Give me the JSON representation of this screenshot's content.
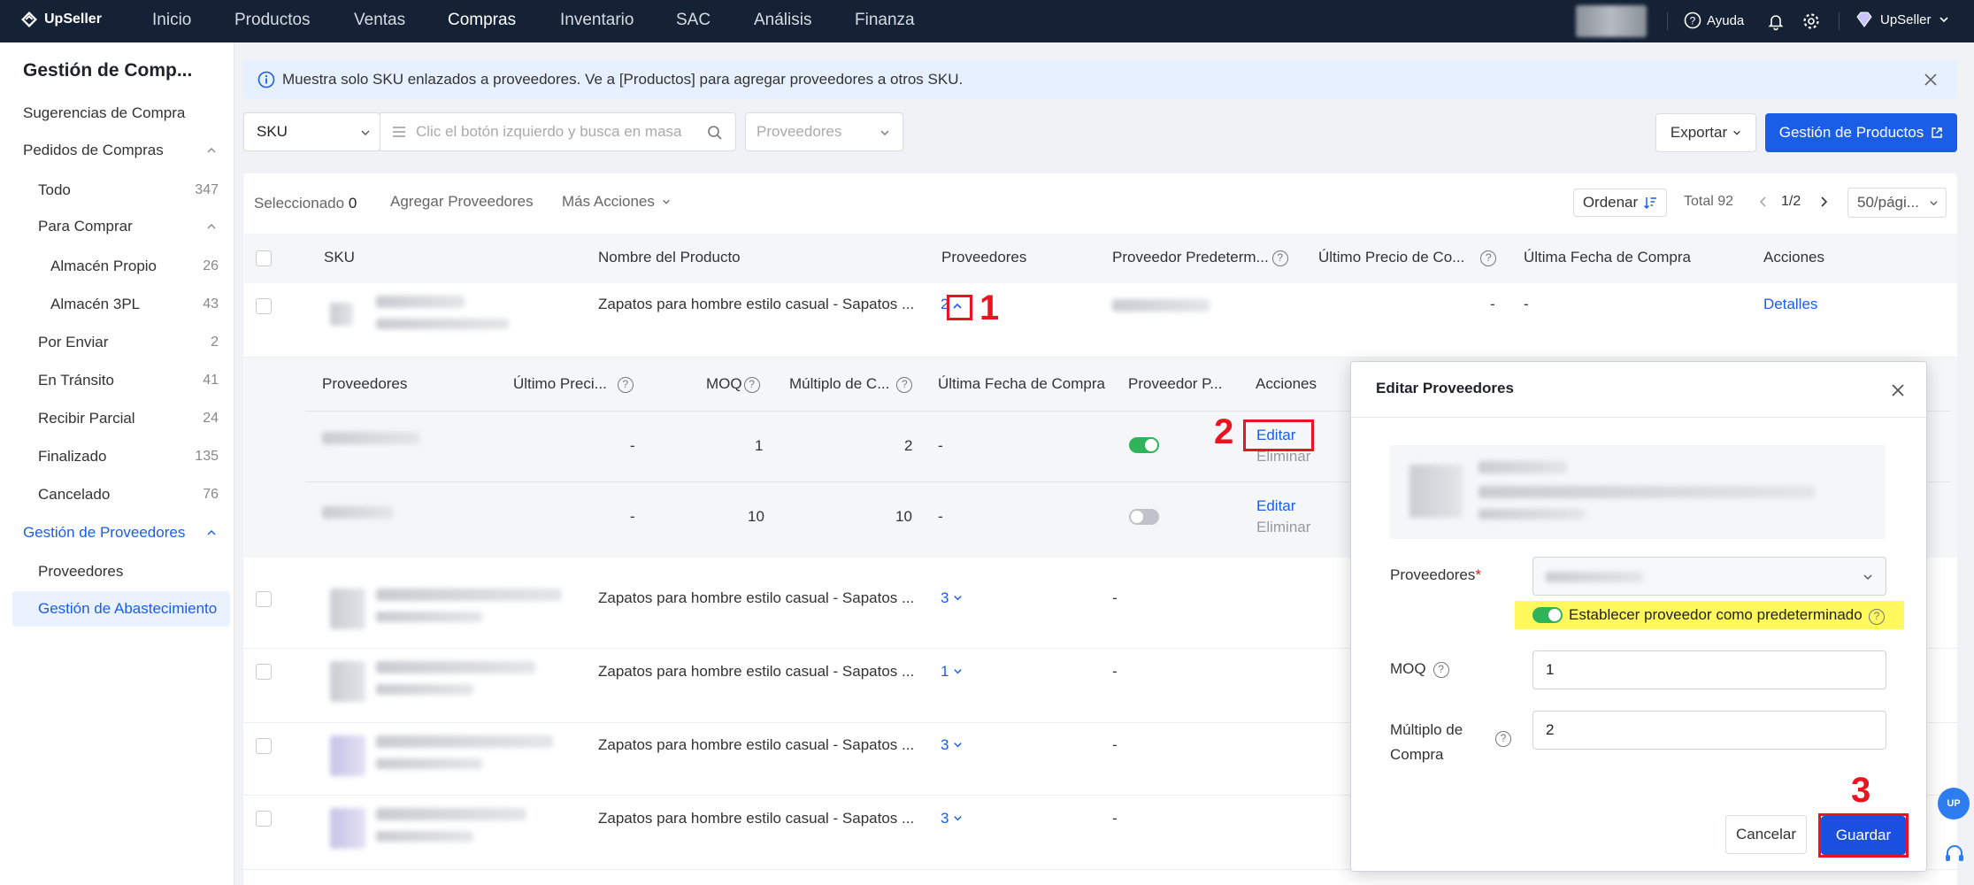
{
  "topnav": {
    "brand": "UpSeller",
    "items": [
      "Inicio",
      "Productos",
      "Ventas",
      "Compras",
      "Inventario",
      "SAC",
      "Análisis",
      "Finanza"
    ],
    "active": "Compras",
    "help": "Ayuda",
    "user": "UpSeller"
  },
  "sidebar": {
    "title": "Gestión de Comp...",
    "sugerencias": "Sugerencias de Compra",
    "pedidos": "Pedidos de Compras",
    "todo": {
      "label": "Todo",
      "count": "347"
    },
    "para_comprar": "Para Comprar",
    "almacen_propio": {
      "label": "Almacén Propio",
      "count": "26"
    },
    "almacen_3pl": {
      "label": "Almacén 3PL",
      "count": "43"
    },
    "por_enviar": {
      "label": "Por Enviar",
      "count": "2"
    },
    "en_transito": {
      "label": "En Tránsito",
      "count": "41"
    },
    "recibir_parcial": {
      "label": "Recibir Parcial",
      "count": "24"
    },
    "finalizado": {
      "label": "Finalizado",
      "count": "135"
    },
    "cancelado": {
      "label": "Cancelado",
      "count": "76"
    },
    "gestion_proveedores": "Gestión de Proveedores",
    "proveedores": "Proveedores",
    "abastecimiento": "Gestión de Abastecimiento"
  },
  "banner": {
    "text": "Muestra solo SKU enlazados a proveedores. Ve a [Productos] para agregar proveedores a otros SKU."
  },
  "filters": {
    "sku_select": "SKU",
    "search_placeholder": "Clic el botón izquierdo y busca en masa",
    "proveedores_placeholder": "Proveedores",
    "exportar": "Exportar",
    "gestion_productos": "Gestión de Productos"
  },
  "toolbar": {
    "seleccionado": "Seleccionado",
    "seleccionado_count": "0",
    "agregar": "Agregar Proveedores",
    "mas_acciones": "Más Acciones",
    "ordenar": "Ordenar",
    "total": "Total 92",
    "page": "1/2",
    "page_size": "50/pági..."
  },
  "table": {
    "headers": {
      "sku": "SKU",
      "nombre": "Nombre del Producto",
      "proveedores": "Proveedores",
      "predeterminado": "Proveedor Predeterm...",
      "ultimo_precio": "Último Precio de Co...",
      "ultima_fecha": "Última Fecha de Compra",
      "acciones": "Acciones"
    },
    "first_row": {
      "nombre": "Zapatos para hombre estilo casual - Sapatos ...",
      "proveedores": "2",
      "precio": "-",
      "fecha": "-",
      "accion": "Detalles"
    },
    "rows": [
      {
        "nombre": "Zapatos para hombre estilo casual - Sapatos ...",
        "proveedores": "3",
        "predeterminado": "-"
      },
      {
        "nombre": "Zapatos para hombre estilo casual - Sapatos ...",
        "proveedores": "1",
        "predeterminado": "-"
      },
      {
        "nombre": "Zapatos para hombre estilo casual - Sapatos ...",
        "proveedores": "3",
        "predeterminado": "-"
      },
      {
        "nombre": "Zapatos para hombre estilo casual - Sapatos ...",
        "proveedores": "3",
        "predeterminado": "-"
      }
    ]
  },
  "subtable": {
    "headers": {
      "proveedores": "Proveedores",
      "ultimo_precio": "Último Preci...",
      "moq": "MOQ",
      "multiplo": "Múltiplo de C...",
      "ultima_fecha": "Última Fecha de Compra",
      "predeterminado": "Proveedor P...",
      "acciones": "Acciones"
    },
    "rows": [
      {
        "precio": "-",
        "moq": "1",
        "multiplo": "2",
        "fecha": "-",
        "default": true,
        "editar": "Editar",
        "eliminar": "Eliminar"
      },
      {
        "precio": "-",
        "moq": "10",
        "multiplo": "10",
        "fecha": "-",
        "default": false,
        "editar": "Editar",
        "eliminar": "Eliminar"
      }
    ]
  },
  "modal": {
    "title": "Editar Proveedores",
    "proveedores_label": "Proveedores",
    "required_mark": "*",
    "default_label": "Establecer proveedor como predeterminado",
    "moq_label": "MOQ",
    "moq_value": "1",
    "multiplo_label_1": "Múltiplo de",
    "multiplo_label_2": "Compra",
    "multiplo_value": "2",
    "cancelar": "Cancelar",
    "guardar": "Guardar"
  },
  "annotations": {
    "step1": "1",
    "step2": "2",
    "step3": "3"
  },
  "colors": {
    "primary": "#1a5ee8",
    "nav_bg": "#152235",
    "toggle_on": "#2fb45a",
    "highlight": "#fff95e",
    "annotation": "#e8141f"
  }
}
